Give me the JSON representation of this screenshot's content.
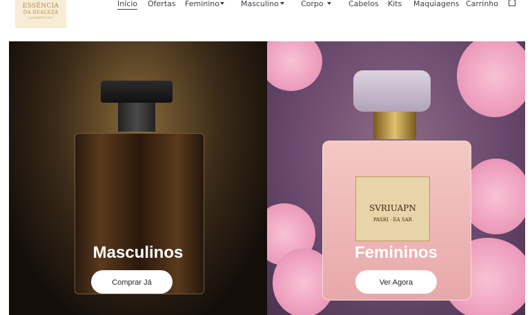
{
  "brand": {
    "line1": "ESSÊNCIA",
    "line2": "DA REALEZA",
    "line3": "COSMÉTICOS"
  },
  "nav": {
    "items": [
      {
        "label": "Início",
        "active": true
      },
      {
        "label": "Ofertas"
      },
      {
        "label": "Feminino",
        "dropdown": true
      },
      {
        "label": "Masculino",
        "dropdown": true
      },
      {
        "label": "Corpo",
        "dropdown": true
      },
      {
        "label": "Cabelos"
      },
      {
        "label": "Kits"
      },
      {
        "label": "Maquiagens"
      },
      {
        "label": "Carrinho"
      }
    ],
    "cart_icon": "shopping-bag-icon"
  },
  "banners": [
    {
      "title": "Masculinos",
      "button_label": "Comprar Já"
    },
    {
      "title": "Femininos",
      "button_label": "Ver Agora",
      "bottle_label_line1": "SVRIUAPN",
      "bottle_label_line2": "PASRI · EA SAR"
    }
  ],
  "colors": {
    "nav_text": "#3b3f45",
    "logo_bg": "#f7ecd6",
    "logo_text": "#b78c3f",
    "button_bg": "#ffffff"
  }
}
